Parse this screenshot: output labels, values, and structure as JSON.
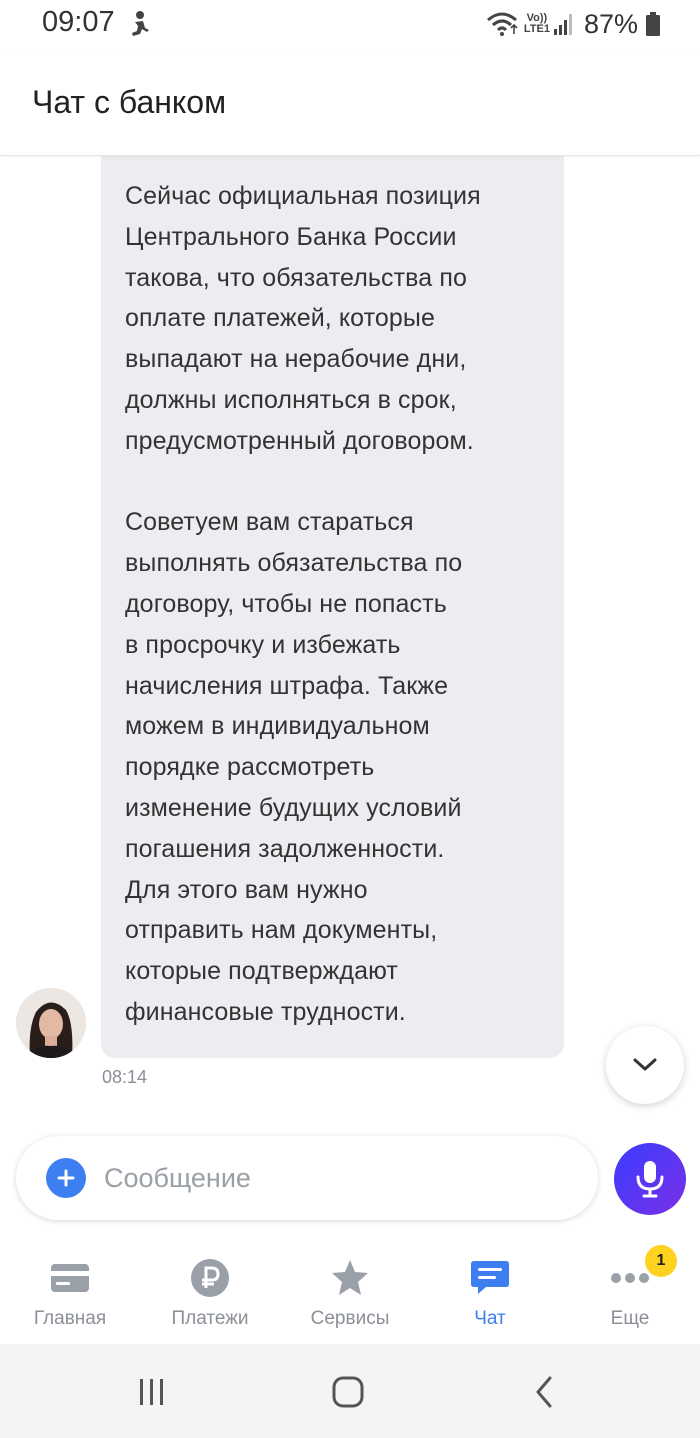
{
  "status_bar": {
    "time": "09:07",
    "network_label_top": "Vo))",
    "network_label_bottom": "LTE1",
    "battery_percent": "87%"
  },
  "header": {
    "title": "Чат с банком"
  },
  "chat": {
    "message_text": "Сейчас официальная позиция\nЦентрального Банка России\nтакова, что обязательства по\nоплате платежей, которые\nвыпадают на нерабочие дни,\nдолжны исполняться в срок,\nпредусмотренный договором.\n\nСоветуем вам стараться\nвыполнять обязательства по\nдоговору, чтобы не попасть\nв просрочку и избежать\nначисления штрафа. Также\nможем в индивидуальном\nпорядке рассмотреть\nизменение будущих условий\nпогашения задолженности.\nДля этого вам нужно\nотправить нам документы,\nкоторые подтверждают\nфинансовые трудности.",
    "message_time": "08:14"
  },
  "input": {
    "placeholder": "Сообщение"
  },
  "bottom_nav": {
    "items": [
      {
        "label": "Главная",
        "icon": "card-icon"
      },
      {
        "label": "Платежи",
        "icon": "ruble-icon"
      },
      {
        "label": "Сервисы",
        "icon": "star-icon"
      },
      {
        "label": "Чат",
        "icon": "chat-icon",
        "active": true
      },
      {
        "label": "Еще",
        "icon": "more-icon"
      }
    ],
    "badge_count": "1"
  },
  "colors": {
    "accent": "#3d7ef0",
    "bubble_bg": "#ebedf0",
    "badge": "#ffd21f",
    "mic_gradient_start": "#3b3cff",
    "mic_gradient_end": "#7a30e8"
  }
}
